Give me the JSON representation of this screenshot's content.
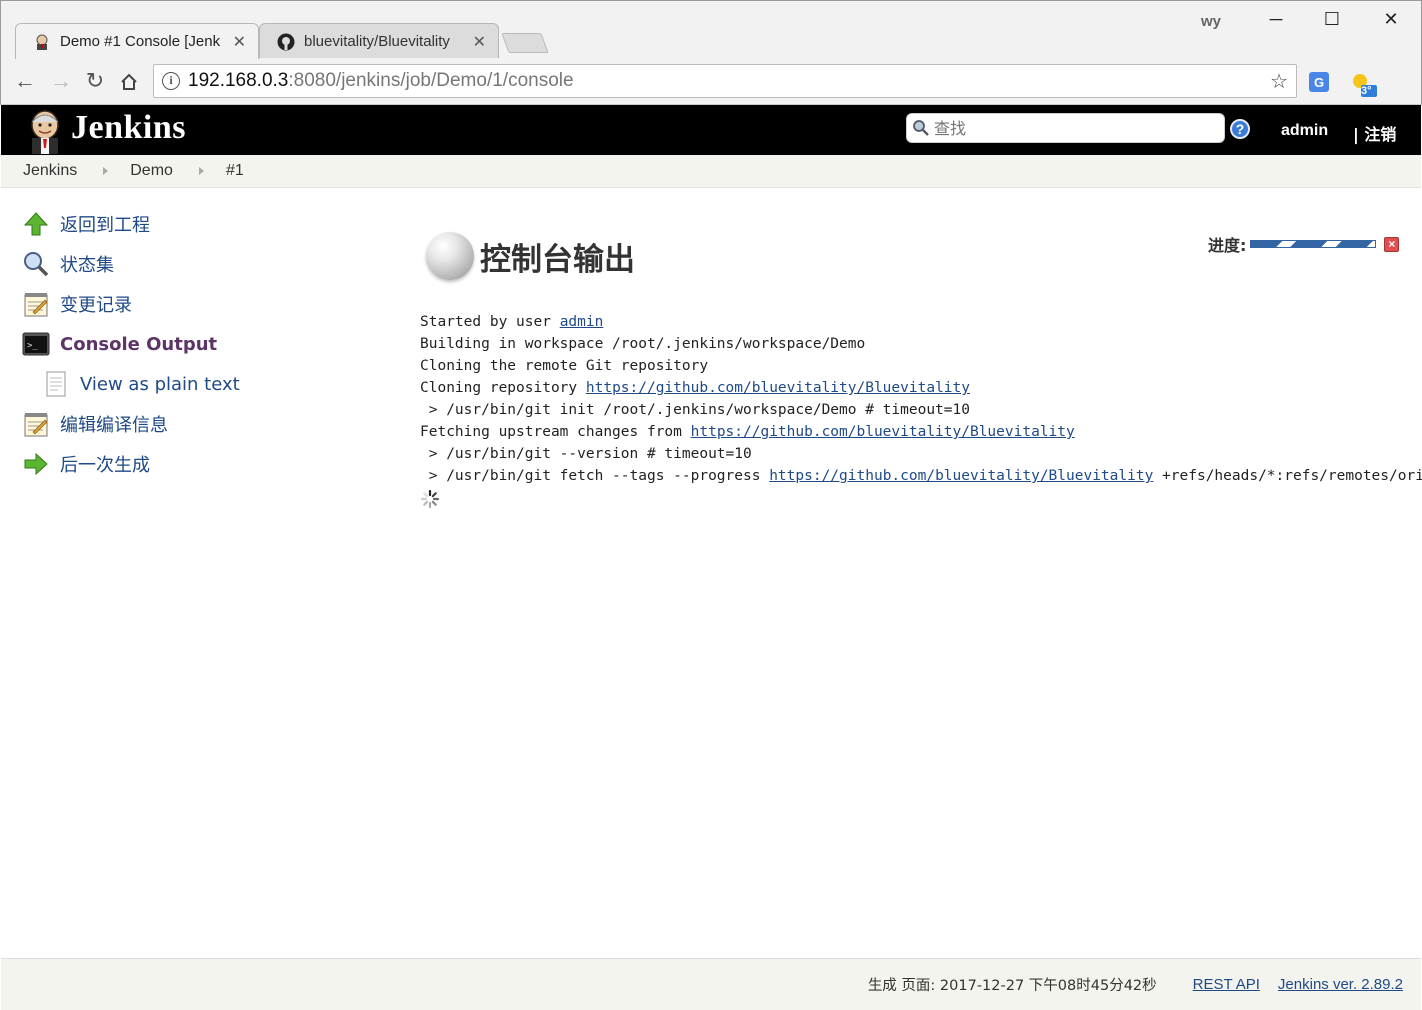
{
  "browser": {
    "tabs": [
      {
        "title": "Demo #1 Console [Jenk",
        "icon": "jenkins-favicon",
        "active": true
      },
      {
        "title": "bluevitality/Bluevitality",
        "icon": "github-icon",
        "active": false
      }
    ],
    "user_badge": "wy",
    "url_host": "192.168.0.3",
    "url_path": ":8080/jenkins/job/Demo/1/console",
    "weather_badge": "3°"
  },
  "header": {
    "brand": "Jenkins",
    "search_placeholder": "查找",
    "help": "?",
    "user": "admin",
    "logout": "| 注销"
  },
  "breadcrumbs": [
    "Jenkins",
    "Demo",
    "#1"
  ],
  "sidebar": {
    "items": [
      {
        "label": "返回到工程",
        "icon": "up-arrow-icon"
      },
      {
        "label": "状态集",
        "icon": "search-icon"
      },
      {
        "label": "变更记录",
        "icon": "notepad-icon"
      },
      {
        "label": "Console Output",
        "icon": "terminal-icon"
      },
      {
        "label": "View as plain text",
        "icon": "document-icon"
      },
      {
        "label": "编辑编译信息",
        "icon": "notepad-icon"
      },
      {
        "label": "后一次生成",
        "icon": "next-arrow-icon"
      }
    ]
  },
  "main": {
    "title": "控制台输出",
    "progress_label": "进度:",
    "console": {
      "l1_text": "Started by user ",
      "l1_link": "admin",
      "l2": "Building in workspace /root/.jenkins/workspace/Demo",
      "l3": "Cloning the remote Git repository",
      "l4_text": "Cloning repository ",
      "l4_link": "https://github.com/bluevitality/Bluevitality",
      "l5": " > /usr/bin/git init /root/.jenkins/workspace/Demo # timeout=10",
      "l6_text": "Fetching upstream changes from ",
      "l6_link": "https://github.com/bluevitality/Bluevitality",
      "l7": " > /usr/bin/git --version # timeout=10",
      "l8_text": " > /usr/bin/git fetch --tags --progress ",
      "l8_link": "https://github.com/bluevitality/Bluevitality",
      "l8_tail": " +refs/heads/*:refs/remotes/origin/*"
    }
  },
  "footer": {
    "generated": "生成 页面: 2017-12-27 下午08时45分42秒",
    "rest_api": "REST API",
    "version": "Jenkins ver. 2.89.2"
  },
  "colors": {
    "link": "#204a87",
    "active_task": "#5c3566",
    "header_bg": "#000000",
    "progress": "#3465a4"
  }
}
